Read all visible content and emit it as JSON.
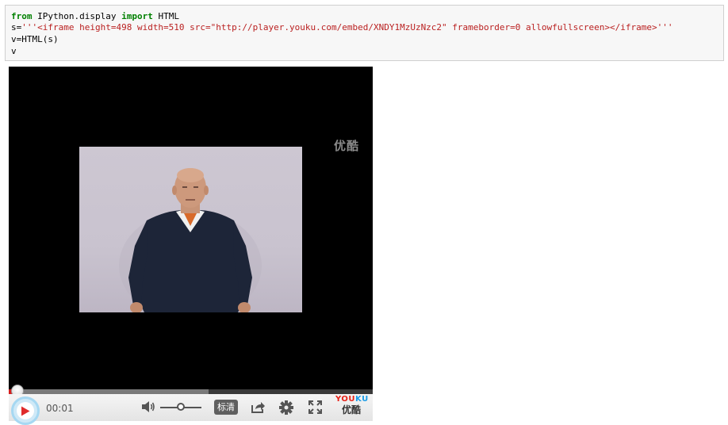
{
  "code_cell": {
    "line1_kw_from": "from",
    "line1_module": " IPython.display ",
    "line1_kw_import": "import",
    "line1_name": " HTML",
    "line2_assign": "s=",
    "line2_string": "'''<iframe height=498 width=510 src=\"http://player.youku.com/embed/XNDY1MzUzNzc2\" frameborder=0 allowfullscreen></iframe>'''",
    "line3": "v=HTML(s)",
    "line4": "v"
  },
  "player": {
    "watermark": "优酷",
    "current_time": "00:01",
    "progress_played": 0.02,
    "progress_buffered": 0.55,
    "volume_level": 0.5,
    "quality_label": "标清",
    "brand_latin_a": "YOU",
    "brand_latin_b": "KU",
    "brand_chinese": "优酷",
    "colors": {
      "progress_played": "#d41e1e",
      "play_ring": "#a6d8f2",
      "play_triangle": "#e02b2b",
      "brand_red": "#e62117",
      "brand_blue": "#1a9be6"
    },
    "icons": [
      "play-icon",
      "volume-icon",
      "share-icon",
      "gear-icon",
      "fullscreen-icon"
    ]
  }
}
